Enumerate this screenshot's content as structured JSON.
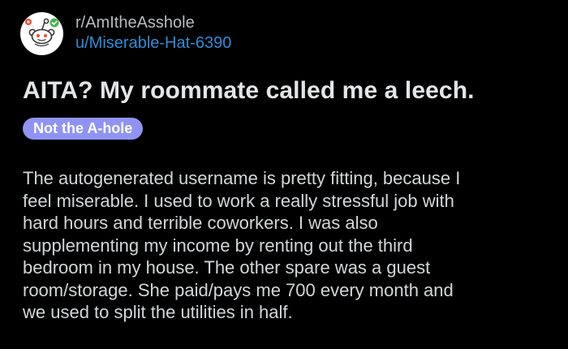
{
  "post": {
    "subreddit": "r/AmItheAsshole",
    "username": "u/Miserable-Hat-6390",
    "title": "AITA? My roommate called me a leech.",
    "flair": "Not the A-hole",
    "flair_color": "#8f93f3",
    "body_lines": [
      "The autogenerated username is pretty fitting, because I",
      "feel miserable. I used to work a really stressful job with",
      "hard hours and terrible coworkers. I was also",
      "supplementing my income by renting out the third",
      "bedroom in my house. The other spare was a guest",
      "room/storage. She paid/pays me 700 every month and",
      "we used to split the utilities in half."
    ]
  },
  "icons": {
    "avatar": "snoo-mascot-icon",
    "badge": "verified-check-icon"
  },
  "colors": {
    "background": "#000000",
    "link": "#2f8bd6"
  }
}
